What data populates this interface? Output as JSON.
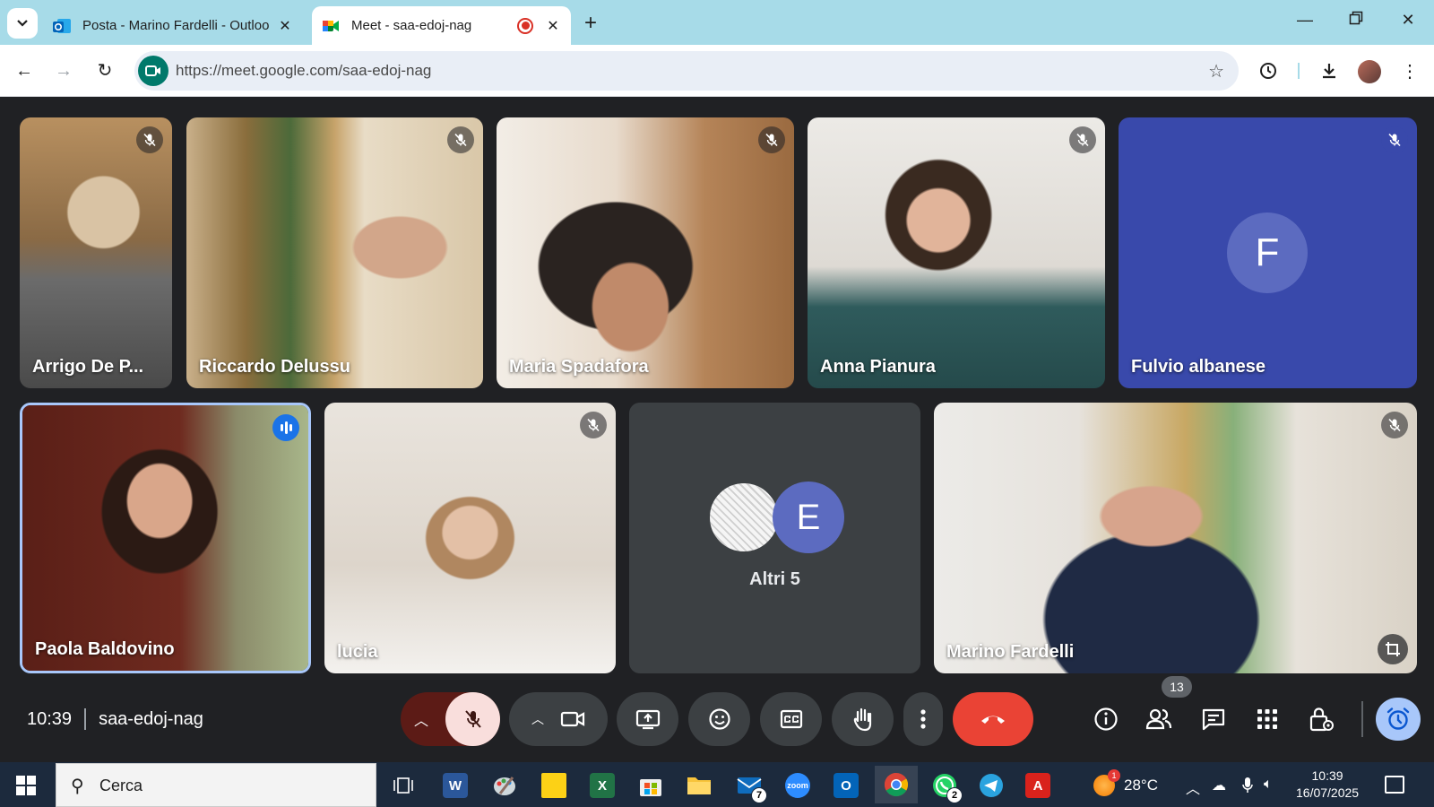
{
  "browser": {
    "tabs": [
      {
        "title": "Posta - Marino Fardelli - Outloo",
        "active": false
      },
      {
        "title": "Meet - saa-edoj-nag",
        "active": true
      }
    ],
    "url": "https://meet.google.com/saa-edoj-nag"
  },
  "meet": {
    "participants": [
      {
        "name": "Arrigo De P...",
        "muted": true
      },
      {
        "name": "Riccardo Delussu",
        "muted": true
      },
      {
        "name": "Maria Spadafora",
        "muted": true
      },
      {
        "name": "Anna Pianura",
        "muted": true
      },
      {
        "name": "Fulvio albanese",
        "muted": true,
        "avatar_letter": "F"
      },
      {
        "name": "Paola Baldovino",
        "muted": false,
        "speaking": true
      },
      {
        "name": "lucia",
        "muted": true
      },
      {
        "name": "Marino Fardelli",
        "muted": true
      }
    ],
    "others": {
      "label": "Altri 5",
      "avatar_letter": "E"
    },
    "bar": {
      "time": "10:39",
      "meeting_code": "saa-edoj-nag",
      "people_count": "13"
    },
    "colors": {
      "end_call": "#ea4335",
      "mic_muted_bg": "#f9dedc",
      "avatar_purple": "#5c6bc0",
      "speaking_border": "#a8c7fa"
    }
  },
  "taskbar": {
    "search_placeholder": "Cerca",
    "mail_badge": "7",
    "whatsapp_badge": "2",
    "weather_alert_badge": "1",
    "temperature": "28°C",
    "time": "10:39",
    "date": "16/07/2025"
  }
}
